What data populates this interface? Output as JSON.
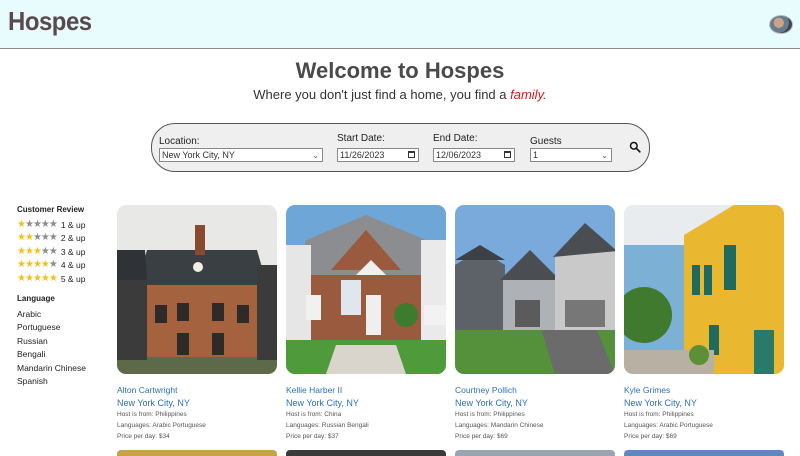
{
  "header": {
    "logo": "Hospes",
    "avatar": "user-avatar"
  },
  "hero": {
    "title": "Welcome to Hospes",
    "tagline_pre": "Where you don't just find a home, you find a ",
    "tagline_emph": "family."
  },
  "search": {
    "location_label": "Location:",
    "location_value": "New York City, NY",
    "start_label": "Start Date:",
    "start_value": "11/26/2023",
    "end_label": "End Date:",
    "end_value": "12/06/2023",
    "guests_label": "Guests",
    "guests_value": "1",
    "search_icon": "search-icon"
  },
  "filters": {
    "review_title": "Customer Review",
    "reviews": [
      {
        "stars": 1,
        "label": "1 & up"
      },
      {
        "stars": 2,
        "label": "2 & up"
      },
      {
        "stars": 3,
        "label": "3 & up"
      },
      {
        "stars": 4,
        "label": "4 & up"
      },
      {
        "stars": 5,
        "label": "5 & up"
      }
    ],
    "language_title": "Language",
    "languages": [
      "Arabic",
      "Portuguese",
      "Russian",
      "Bengali",
      "Mandarin Chinese",
      "Spanish"
    ]
  },
  "listings": [
    {
      "name": "Alton Cartwright",
      "city": "New York City, NY",
      "from": "Host is from: Philippines",
      "languages": "Languages: Arabic Portuguese",
      "price": "Price per day: $34"
    },
    {
      "name": "Kellie Harber II",
      "city": "New York City, NY",
      "from": "Host is from: China",
      "languages": "Languages: Russian Bengali",
      "price": "Price per day: $37"
    },
    {
      "name": "Courtney Pollich",
      "city": "New York City, NY",
      "from": "Host is from: Philippines",
      "languages": "Languages: Mandarin Chinese",
      "price": "Price per day: $69"
    },
    {
      "name": "Kyle Grimes",
      "city": "New York City, NY",
      "from": "Host is from: Philippines",
      "languages": "Languages: Arabic Portuguese",
      "price": "Price per day: $69"
    }
  ],
  "colors": {
    "header_bg": "#e9fcfd",
    "link": "#2f6fb5",
    "accent": "#d21a1a",
    "star": "#f2c21b"
  }
}
